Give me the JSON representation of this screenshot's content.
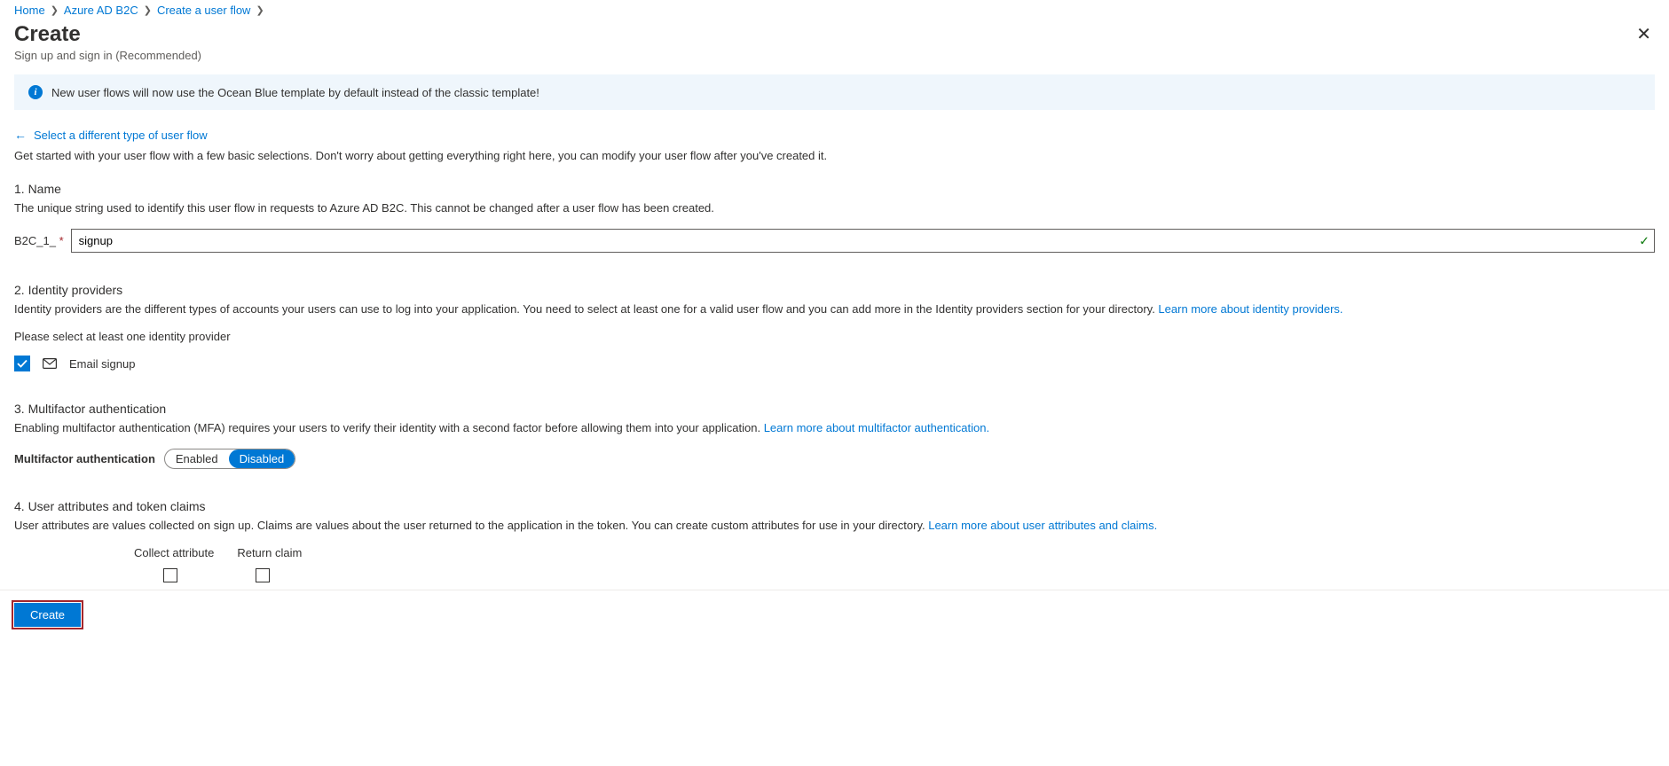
{
  "breadcrumb": {
    "home": "Home",
    "b2c": "Azure AD B2C",
    "flow": "Create a user flow"
  },
  "header": {
    "title": "Create",
    "subtitle": "Sign up and sign in (Recommended)"
  },
  "banner": {
    "text": "New user flows will now use the Ocean Blue template by default instead of the classic template!"
  },
  "back_link": "Select a different type of user flow",
  "intro": "Get started with your user flow with a few basic selections. Don't worry about getting everything right here, you can modify your user flow after you've created it.",
  "section_name": {
    "title": "1. Name",
    "desc": "The unique string used to identify this user flow in requests to Azure AD B2C. This cannot be changed after a user flow has been created.",
    "prefix": "B2C_1_",
    "value": "signup"
  },
  "section_idp": {
    "title": "2. Identity providers",
    "desc": "Identity providers are the different types of accounts your users can use to log into your application. You need to select at least one for a valid user flow and you can add more in the Identity providers section for your directory. ",
    "link": "Learn more about identity providers.",
    "prompt": "Please select at least one identity provider",
    "option": "Email signup"
  },
  "section_mfa": {
    "title": "3. Multifactor authentication",
    "desc": "Enabling multifactor authentication (MFA) requires your users to verify their identity with a second factor before allowing them into your application. ",
    "link": "Learn more about multifactor authentication.",
    "label": "Multifactor authentication",
    "enabled": "Enabled",
    "disabled": "Disabled"
  },
  "section_attr": {
    "title": "4. User attributes and token claims",
    "desc": "User attributes are values collected on sign up. Claims are values about the user returned to the application in the token. You can create custom attributes for use in your directory. ",
    "link": "Learn more about user attributes and claims.",
    "col1": "Collect attribute",
    "col2": "Return claim"
  },
  "footer": {
    "create": "Create"
  }
}
